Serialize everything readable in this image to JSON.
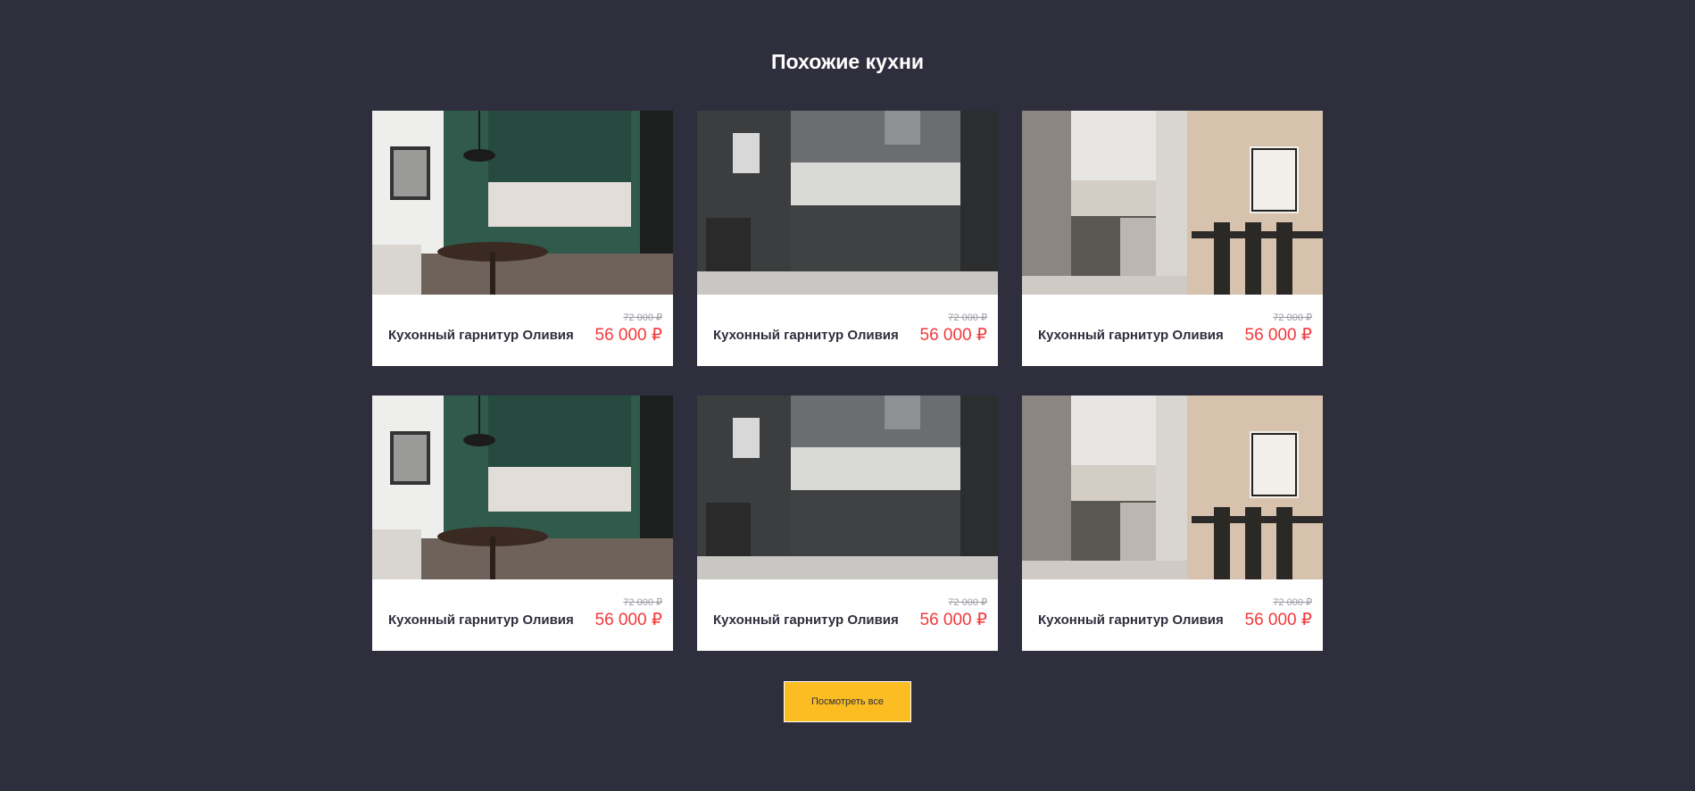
{
  "section": {
    "title": "Похожие кухни"
  },
  "products": [
    {
      "name": "Кухонный гарнитур Оливия",
      "old_price": "72 000 ₽",
      "price": "56 000 ₽",
      "image": "kitchen-green-photo"
    },
    {
      "name": "Кухонный гарнитур Оливия",
      "old_price": "72 000 ₽",
      "price": "56 000 ₽",
      "image": "kitchen-graphite-photo"
    },
    {
      "name": "Кухонный гарнитур Оливия",
      "old_price": "72 000 ₽",
      "price": "56 000 ₽",
      "image": "kitchen-light-wood-photo"
    },
    {
      "name": "Кухонный гарнитур Оливия",
      "old_price": "72 000 ₽",
      "price": "56 000 ₽",
      "image": "kitchen-green-photo"
    },
    {
      "name": "Кухонный гарнитур Оливия",
      "old_price": "72 000 ₽",
      "price": "56 000 ₽",
      "image": "kitchen-graphite-photo"
    },
    {
      "name": "Кухонный гарнитур Оливия",
      "old_price": "72 000 ₽",
      "price": "56 000 ₽",
      "image": "kitchen-light-wood-photo"
    }
  ],
  "view_all_label": "Посмотреть все",
  "colors": {
    "background": "#2f2e3d",
    "card": "#ffffff",
    "price": "#f2383a",
    "old_price": "#9a9aa3",
    "button": "#fbbd22"
  }
}
